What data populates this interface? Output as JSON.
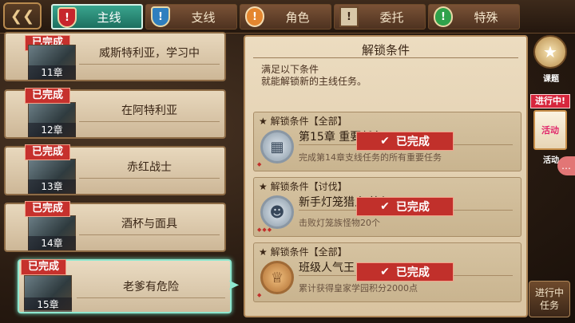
{
  "tabs": [
    {
      "label": "主线",
      "icon": "!",
      "active": true
    },
    {
      "label": "支线",
      "icon": "!",
      "active": false
    },
    {
      "label": "角色",
      "icon": "!",
      "active": false
    },
    {
      "label": "委托",
      "icon": "!",
      "active": false
    },
    {
      "label": "特殊",
      "icon": "!",
      "active": false
    }
  ],
  "chapters": [
    {
      "title": "威斯特利亚，学习中",
      "num": "11章",
      "badge": "已完成"
    },
    {
      "title": "在阿特利亚",
      "num": "12章",
      "badge": "已完成"
    },
    {
      "title": "赤红战士",
      "num": "13章",
      "badge": "已完成"
    },
    {
      "title": "酒杯与面具",
      "num": "14章",
      "badge": "已完成"
    },
    {
      "title": "老爹有危险",
      "num": "15章",
      "badge": "已完成"
    }
  ],
  "panel": {
    "title": "解锁条件",
    "desc_line1": "满足以下条件",
    "desc_line2": "就能解锁新的主线任务。",
    "conditions": [
      {
        "header": "解锁条件【全部】",
        "name": "第15章 重要任务",
        "desc": "完成第14章支线任务的所有重要任务",
        "stamp": "已完成",
        "icon": "book"
      },
      {
        "header": "解锁条件【讨伐】",
        "name": "新手灯笼猎人 等级3",
        "desc": "击败灯笼族怪物20个",
        "stamp": "已完成",
        "icon": "cat"
      },
      {
        "header": "解锁条件【全部】",
        "name": "班级人气王",
        "desc": "累计获得皇家学园积分2000点",
        "stamp": "已完成",
        "icon": "medal"
      }
    ]
  },
  "side": {
    "course_label": "课题",
    "event_tag": "进行中!",
    "event_card": "活动",
    "event_label": "活动",
    "ongoing_line1": "进行中",
    "ongoing_line2": "任务"
  }
}
